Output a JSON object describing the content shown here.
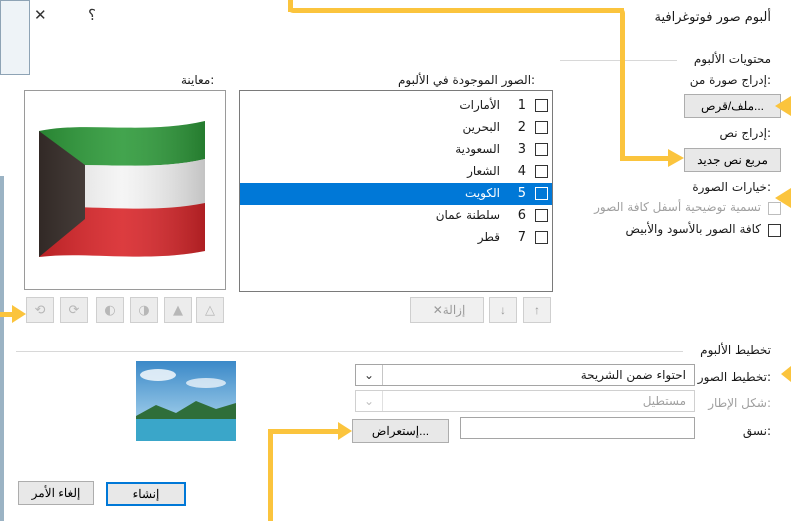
{
  "dialog": {
    "title": "ألبوم صور فوتوغرافية",
    "help_glyph": "؟",
    "close_glyph": "✕"
  },
  "album_content": {
    "section_label": "محتويات الألبوم",
    "insert_picture_label": "إدراج صورة من:",
    "file_disk_button": "ملف/قرص...",
    "insert_text_label": "إدراج نص:",
    "new_text_box_button": "مربع نص جديد",
    "picture_options_label": "خيارات الصورة:",
    "captions_below_all": "تسمية توضيحية أسفل كافة الصور",
    "all_black_and_white": "كافة الصور بالأسود والأبيض"
  },
  "pictures_in_album": {
    "label": "الصور الموجودة في الألبوم:",
    "items": [
      {
        "num": "1",
        "name": "الأمارات",
        "selected": false
      },
      {
        "num": "2",
        "name": "البحرين",
        "selected": false
      },
      {
        "num": "3",
        "name": "السعودية",
        "selected": false
      },
      {
        "num": "4",
        "name": "الشعار",
        "selected": false
      },
      {
        "num": "5",
        "name": "الكويت",
        "selected": true
      },
      {
        "num": "6",
        "name": "سلطنة عمان",
        "selected": false
      },
      {
        "num": "7",
        "name": "قطر",
        "selected": false
      }
    ],
    "remove_button": "إزالة",
    "move_up_glyph": "↑",
    "move_down_glyph": "↓"
  },
  "preview": {
    "label": "معاينة:",
    "flag_colors": {
      "green": "#2e9a3a",
      "white": "#f4f4f4",
      "red": "#d8262a",
      "black": "#3a302c"
    }
  },
  "album_layout": {
    "section_label": "تخطيط الألبوم",
    "picture_layout_label": "تخطيط الصور:",
    "picture_layout_value": "احتواء ضمن الشريحة",
    "frame_shape_label": "شكل الإطار:",
    "frame_shape_value": "مستطيل",
    "theme_label": "نسق:",
    "theme_value": "",
    "browse_button": "إستعراض..."
  },
  "footer": {
    "create_button": "إنشاء",
    "cancel_button": "إلغاء الأمر"
  },
  "colors": {
    "accent": "#0078d7",
    "callout": "#fbc43d"
  },
  "icons": [
    "close-icon",
    "help-icon",
    "rotate-left-icon",
    "rotate-right-icon",
    "contrast-up-icon",
    "contrast-down-icon",
    "brightness-up-icon",
    "brightness-down-icon",
    "remove-x-icon",
    "arrow-up-icon",
    "arrow-down-icon"
  ]
}
